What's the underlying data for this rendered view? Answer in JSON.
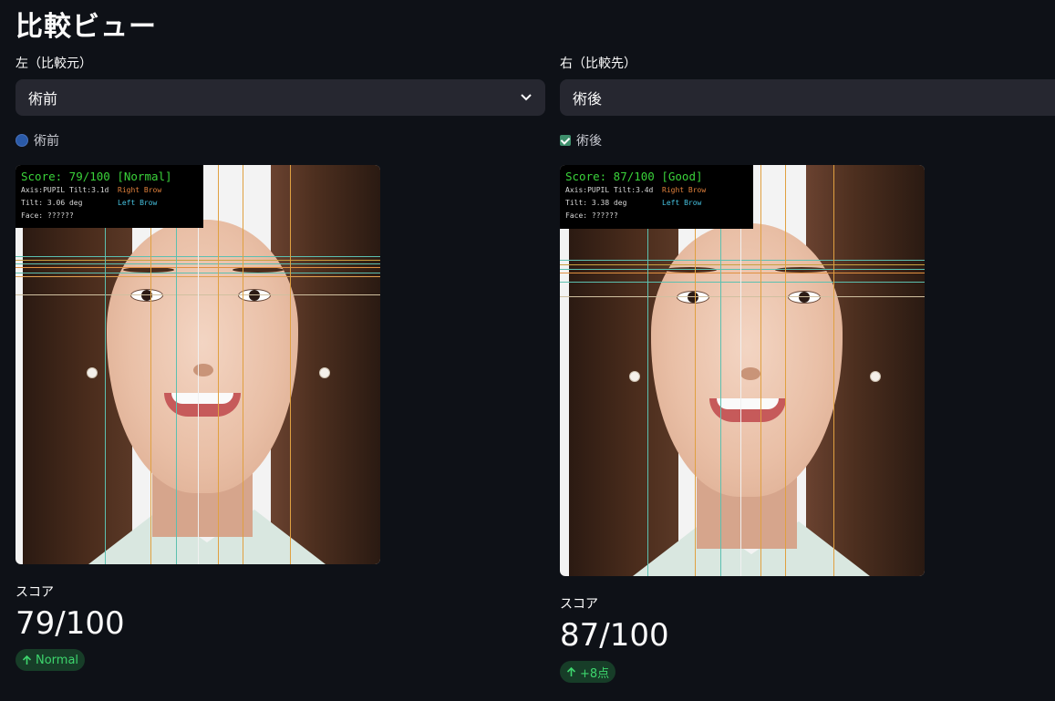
{
  "page_title": "比較ビュー",
  "left": {
    "label": "左（比較元）",
    "selected": "術前",
    "legend": "術前",
    "overlay": {
      "score": "Score: 79/100 [Normal]",
      "axis": "Axis:PUPIL Tilt:3.1d",
      "tilt": "Tilt: 3.06 deg",
      "face": "Face: ??????",
      "right_brow": "Right Brow",
      "left_brow": "Left Brow"
    },
    "metric_label": "スコア",
    "metric_value": "79/100",
    "delta": "Normal"
  },
  "right": {
    "label": "右（比較先）",
    "selected": "術後",
    "legend": "術後",
    "overlay": {
      "score": "Score: 87/100 [Good]",
      "axis": "Axis:PUPIL Tilt:3.4d",
      "tilt": "Tilt: 3.38 deg",
      "face": "Face: ??????",
      "right_brow": "Right Brow",
      "left_brow": "Left Brow"
    },
    "metric_label": "スコア",
    "metric_value": "87/100",
    "delta": "+8点"
  },
  "icons": {
    "select_chevron": "chevron-down-icon",
    "delta_arrow": "arrow-up-icon"
  },
  "colors": {
    "background": "#0e1117",
    "select_bg": "#262730",
    "delta_bg": "#173d28",
    "delta_text": "#3dd56d",
    "overlay_score": "#3ad23a"
  }
}
